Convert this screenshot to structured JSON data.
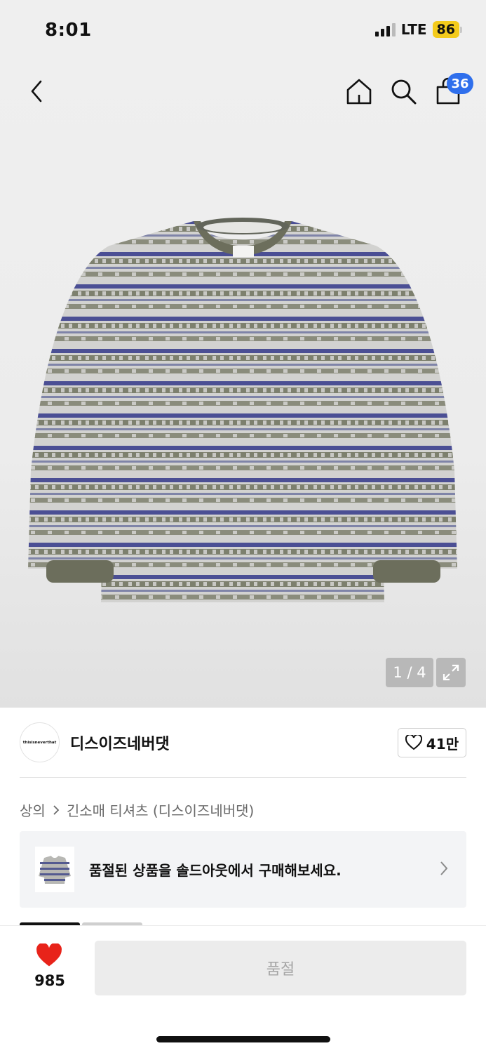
{
  "status": {
    "time": "8:01",
    "network": "LTE",
    "battery": "86"
  },
  "header": {
    "cart_count": "36"
  },
  "gallery": {
    "pager": "1 / 4"
  },
  "brand": {
    "logo_text": "thisisneverthat",
    "name": "디스이즈네버댓",
    "likes": "41만"
  },
  "breadcrumb": {
    "category": "상의",
    "subcategory": "긴소매 티셔츠 (디스이즈네버댓)"
  },
  "soldout_banner": {
    "text": "품절된 상품을 솔드아웃에서 구매해보세요."
  },
  "bottom": {
    "wish_count": "985",
    "buy_label": "품절"
  },
  "colors": {
    "accent": "#2f6fec",
    "heart": "#e8231a",
    "battery": "#f4cb1c",
    "disabled": "#ececec"
  },
  "icons": [
    "back-icon",
    "home-icon",
    "search-icon",
    "bag-icon",
    "expand-icon",
    "heart-outline-icon",
    "chevron-right-icon",
    "chevron-right-icon",
    "heart-filled-icon"
  ]
}
